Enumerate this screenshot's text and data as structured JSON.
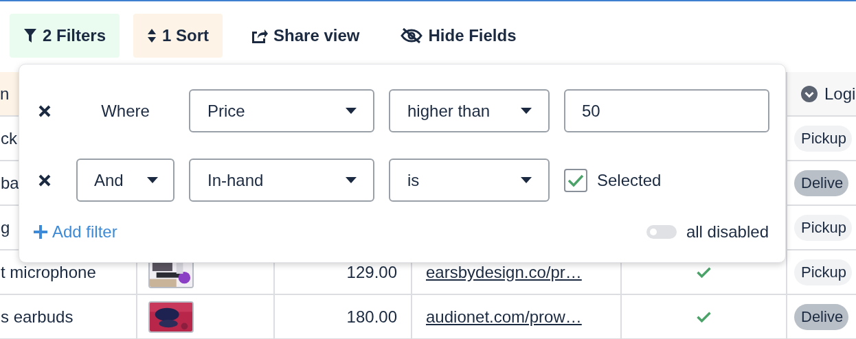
{
  "toolbar": [
    {
      "kind": "filter",
      "label": "2 Filters"
    },
    {
      "kind": "sort",
      "label": "1 Sort"
    },
    {
      "kind": "share",
      "label": "Share view"
    },
    {
      "kind": "hide",
      "label": "Hide Fields"
    }
  ],
  "table": {
    "header": {
      "column_1": {
        "label": "n",
        "sorted": true
      },
      "column_6": {
        "label": "Logi",
        "sorted": false
      }
    },
    "rows": [
      {
        "column_1": "ck",
        "column_6": {
          "label": "Pickup",
          "color": "#f1f2f4"
        }
      },
      {
        "column_1": "ba",
        "column_6": {
          "label": "Delive",
          "color": "#b9bfc7"
        }
      },
      {
        "column_1": "g",
        "column_6": {
          "label": "Pickup",
          "color": "#f1f2f4"
        }
      },
      {
        "column_1": "t microphone",
        "column_3": "129.00",
        "column_4": "earsbydesign.co/pr…",
        "column_5": {
          "checked": true
        },
        "column_6": {
          "label": "Pickup",
          "color": "#f1f2f4"
        }
      },
      {
        "column_1": "s earbuds",
        "column_3": "180.00",
        "column_4": "audionet.com/prow…",
        "column_5": {
          "checked": true
        },
        "column_6": {
          "label": "Delive",
          "color": "#b9bfc7"
        }
      }
    ]
  },
  "filter_panel": {
    "filters": [
      {
        "connector": {
          "kind": "label",
          "text": "Where"
        },
        "field": "Price",
        "operator": "higher than",
        "value": {
          "kind": "input",
          "text": "50"
        }
      },
      {
        "connector": {
          "kind": "select",
          "text": "And"
        },
        "field": "In-hand",
        "operator": "is",
        "value": {
          "kind": "checkbox",
          "checked": true,
          "label": "Selected"
        }
      }
    ],
    "add_filter": "Add filter",
    "toggle": {
      "on": false,
      "label": "all disabled"
    }
  }
}
